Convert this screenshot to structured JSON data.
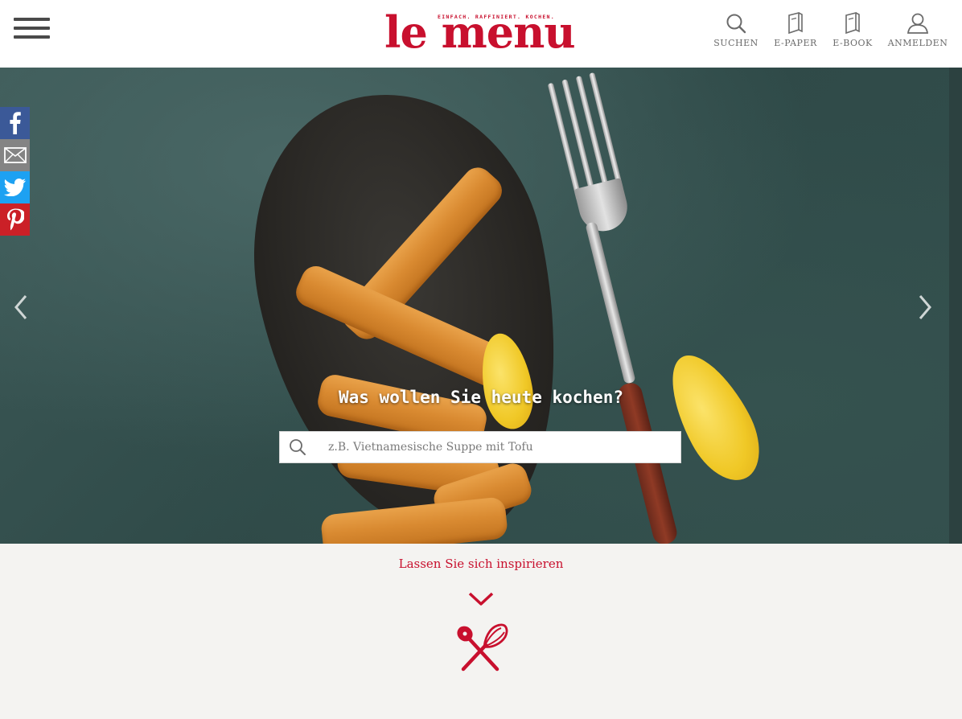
{
  "header": {
    "logo_text": "le menu",
    "logo_tagline": "EINFACH. RAFFINIERT. KOCHEN.",
    "nav": [
      {
        "label": "SUCHEN",
        "icon": "search-icon"
      },
      {
        "label": "E-PAPER",
        "icon": "book-icon"
      },
      {
        "label": "E-BOOK",
        "icon": "book-icon"
      },
      {
        "label": "ANMELDEN",
        "icon": "user-icon"
      }
    ]
  },
  "hero": {
    "heading": "Was wollen Sie heute kochen?",
    "search_placeholder": "z.B. Vietnamesische Suppe mit Tofu"
  },
  "social": [
    "facebook-icon",
    "mail-icon",
    "twitter-icon",
    "pinterest-icon"
  ],
  "inspire_label": "Lassen Sie sich inspirieren",
  "colors": {
    "brand_red": "#c8102e",
    "header_bg": "#ffffff",
    "page_bg": "#f4f3f1",
    "nav_text": "#6b6b6b",
    "facebook": "#3b5998",
    "mail": "#848484",
    "twitter": "#1da1f2",
    "pinterest": "#cb2027"
  }
}
